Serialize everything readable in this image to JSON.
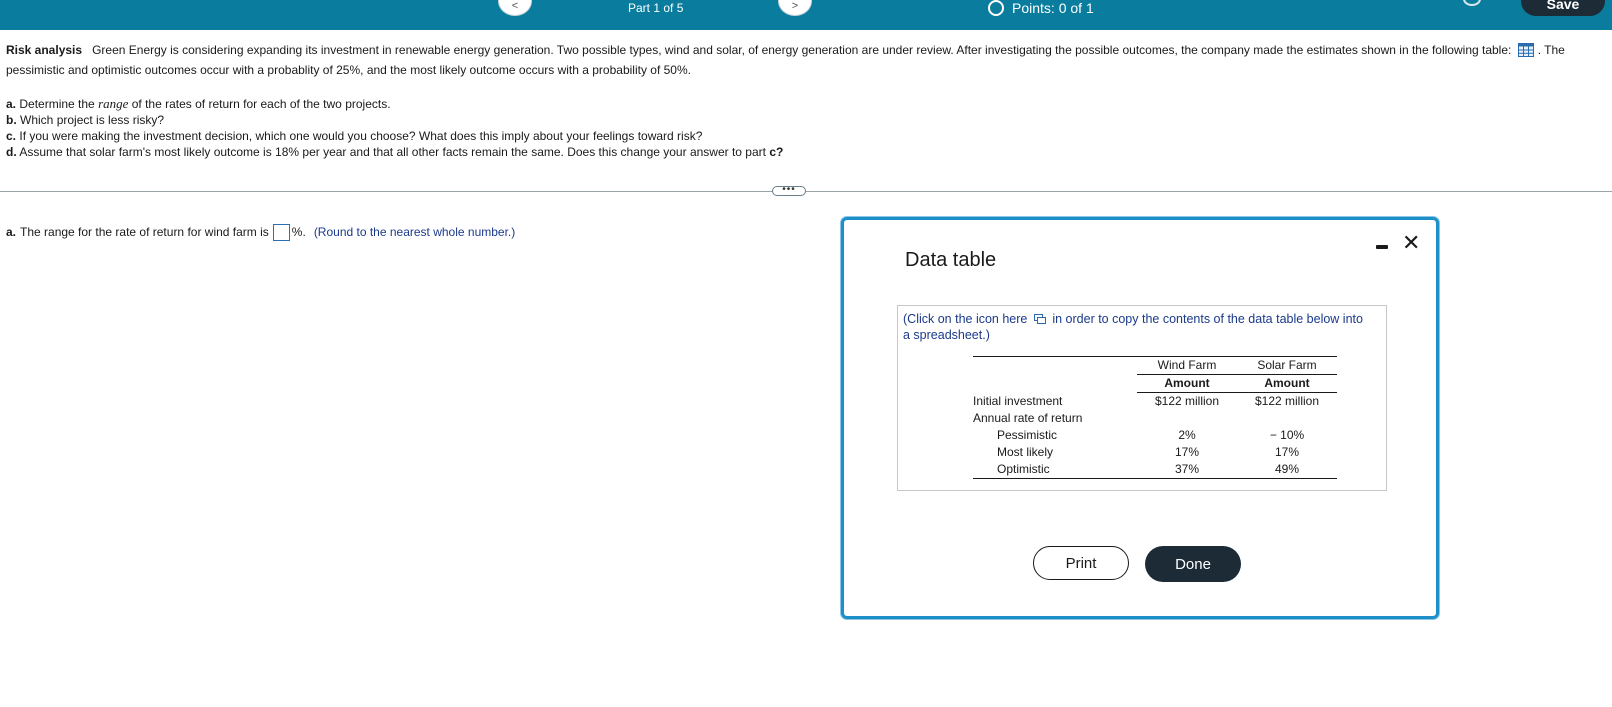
{
  "header": {
    "part_label": "Part 1 of 5",
    "points_label": "Points:",
    "points_value": "0 of 1",
    "save_label": "Save",
    "prev_label": "<",
    "next_label": ">"
  },
  "question": {
    "title": "Risk analysis",
    "body_1": "Green Energy is considering expanding its investment in renewable energy generation.  Two possible types,  wind and solar, of energy generation are under review.  After investigating the possible outcomes, the company made the estimates shown in the following table:",
    "body_2": ". The pessimistic and optimistic outcomes occur with a probablity of 25%, and the most likely outcome occurs with a probability of 50%.",
    "parts": [
      {
        "letter": "a.",
        "pre": "Determine the ",
        "em": "range",
        "post": " of the rates of return for each of the two projects."
      },
      {
        "letter": "b.",
        "text": "Which project is less risky?"
      },
      {
        "letter": "c.",
        "text": "If you were making the investment decision, which one would you choose?  What does this imply about your feelings toward risk?"
      },
      {
        "letter": "d.",
        "text": "Assume that solar farm's most likely outcome is 18% per year and that all other facts remain the same.  Does this change your answer to part ",
        "bold_tail": "c?"
      }
    ]
  },
  "divider_handle": "•••",
  "answer": {
    "letter": "a.",
    "text": "The range for the rate of return for wind farm is",
    "value": "",
    "suffix": "%.",
    "hint": "(Round to the nearest whole number.)"
  },
  "modal": {
    "title": "Data table",
    "close_symbol": "✕",
    "copy_note_pre": "(Click on the icon here",
    "copy_note_post": "in order to copy the contents of the data table below into a spreadsheet.)",
    "columns": [
      "Wind Farm",
      "Solar Farm"
    ],
    "subheader": [
      "Amount",
      "Amount"
    ],
    "rows": [
      {
        "label": "Initial investment",
        "wind": "$122 million",
        "solar": "$122 million"
      },
      {
        "label": "Annual rate of return",
        "wind": "",
        "solar": ""
      },
      {
        "label": "Pessimistic",
        "wind": "2%",
        "solar": "− 10%"
      },
      {
        "label": "Most likely",
        "wind": "17%",
        "solar": "17%"
      },
      {
        "label": "Optimistic",
        "wind": "37%",
        "solar": "49%"
      }
    ],
    "print_label": "Print",
    "done_label": "Done"
  },
  "colors": {
    "topbar": "#0a7d9e",
    "modal_border": "#1d90c9",
    "dark_button": "#1c2b36",
    "hint_text": "#1b3a8c"
  },
  "icons": [
    "chevron-left-icon",
    "chevron-right-icon",
    "radio-ring-icon",
    "settings-icon",
    "table-grid-icon",
    "copy-icon",
    "minimize-icon",
    "close-icon"
  ]
}
